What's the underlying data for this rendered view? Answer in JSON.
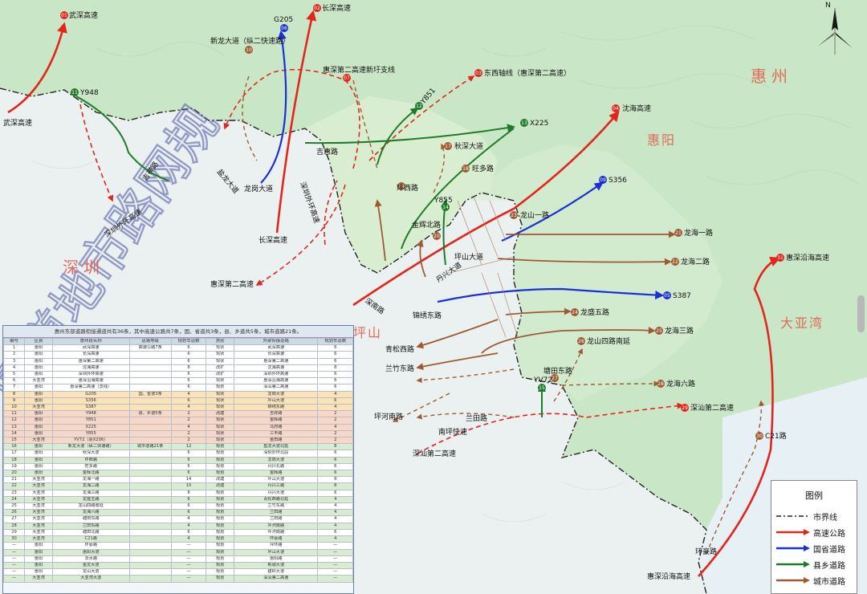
{
  "regions": {
    "shenzhen": "深圳",
    "huizhou": "惠州",
    "huiyang": "惠阳",
    "pingshan": "坪山",
    "dayawan": "大亚湾"
  },
  "watermark": "圆道地市路网规",
  "compass_label": "N",
  "colors": {
    "expressway": "#e3261d",
    "national_provincial": "#1b2fd6",
    "county_township": "#1f7a2a",
    "urban": "#a05a33",
    "boundary": "#222222"
  },
  "legend": {
    "title": "图例",
    "items": [
      {
        "label": "市界线",
        "style": "dashdot",
        "color": "#222222"
      },
      {
        "label": "高速公路",
        "style": "arrow",
        "color": "#e3261d"
      },
      {
        "label": "国省道路",
        "style": "arrow",
        "color": "#1b2fd6"
      },
      {
        "label": "县乡道路",
        "style": "arrow",
        "color": "#1f7a2a"
      },
      {
        "label": "城市道路",
        "style": "arrow",
        "color": "#a05a33"
      }
    ]
  },
  "map_labels": {
    "wushen_top": "武深高速",
    "wushen_left": "武深高速",
    "changshen_top": "长深高速",
    "changshen_mid": "长深高速",
    "g205": "G205",
    "xinlong": "新龙大道（纵二快速路）",
    "huishen2_new": "惠深第二高速新圩支线",
    "dongxi": "东西轴线（惠深第二高速）",
    "y948": "Y948",
    "jixiang": "吉祥路",
    "y851": "Y851",
    "shenhai": "沈海高速",
    "huiyang": "惠阳",
    "x225": "X225",
    "jihui": "吉惠路",
    "qiushen": "秋深大道",
    "yanglian": "盐龙大道",
    "longgang": "龙岗大道",
    "wangduo": "旺多路",
    "huanxi": "环西路",
    "shenhuan_out": "深圳外环高速",
    "shenhuan_in": "深圳外环高速",
    "s356": "S356",
    "y855": "Y855",
    "jinhui_n": "金辉北路",
    "longshan_rd": "龙山一路",
    "longhai1": "龙海一路",
    "longhai2": "龙海二路",
    "huishen_coast": "惠深沿海高速",
    "huishen2": "惠深第二高速",
    "shennan": "深南路",
    "s387": "S387",
    "pingshan_rd": "坪山大道",
    "danxing": "丹兴大道",
    "jinsui": "锦绣东路",
    "longsheng5": "龙盛五路",
    "longhai3": "龙海三路",
    "longshan4": "龙山四路南延",
    "qingsong": "青松西路",
    "lanzhu": "兰竹东路",
    "tangtian": "塘田东路",
    "yv72": "YV72",
    "longhai6": "龙海六路",
    "pinghe_s": "坪河南路",
    "lantian": "兰田路",
    "shenshan2": "深汕第二高速",
    "shenshan2_b": "深汕第二高速",
    "nanping": "南坪快速",
    "c21": "C21路",
    "huanhao": "环豪路",
    "huishen_coast_b": "惠深沿海高速"
  },
  "badges": [
    "01",
    "06",
    "02",
    "07",
    "03",
    "04",
    "10",
    "12",
    "14",
    "17",
    "18",
    "19",
    "20",
    "21",
    "22",
    "23",
    "24",
    "25",
    "26",
    "27",
    "28",
    "29",
    "30",
    "31",
    "05",
    "09",
    "11",
    "13",
    "15"
  ],
  "summary_table": {
    "title": "惠州东部道路衔接通道共有36条，其中高速公路共7条，国、省道共3条，县、乡道共5条，城市道路21条。",
    "headers": [
      "编号",
      "区县",
      "惠州段名称",
      "道路等级",
      "规划车道数",
      "类别",
      "外部衔接道路",
      "规划车道数"
    ],
    "rows": [
      [
        "1",
        "惠阳",
        "武深高速",
        "高速公路7条",
        "6",
        "现状",
        "武深高速",
        "6"
      ],
      [
        "2",
        "惠阳",
        "长深高速",
        "",
        "6",
        "现状",
        "长深高速",
        "6"
      ],
      [
        "3",
        "惠阳",
        "惠深第二高速",
        "",
        "6",
        "现状",
        "惠深第二高速",
        "6"
      ],
      [
        "4",
        "惠阳",
        "沈海高速",
        "",
        "8",
        "改扩",
        "沈海高速",
        "8"
      ],
      [
        "5",
        "惠阳",
        "深圳外环高速",
        "",
        "6",
        "改扩",
        "深圳外环高速",
        "6"
      ],
      [
        "6",
        "大亚湾",
        "惠深沿海高速",
        "",
        "6",
        "现状",
        "惠深沿海高速",
        "6"
      ],
      [
        "7",
        "惠阳",
        "惠深第二高速（支线）",
        "",
        "6",
        "规划",
        "深汕第二高速",
        "6"
      ],
      [
        "8",
        "惠阳",
        "G205",
        "国、省道3条",
        "4",
        "现状",
        "龙岗大道",
        "4"
      ],
      [
        "9",
        "惠阳",
        "S356",
        "",
        "6",
        "现状",
        "坪山大道",
        "6"
      ],
      [
        "10",
        "大亚湾",
        "S387",
        "",
        "4",
        "现状",
        "锦绣东路",
        "4"
      ],
      [
        "11",
        "惠阳",
        "Y948",
        "县、乡道5条",
        "2",
        "改建",
        "吉祥路",
        "2"
      ],
      [
        "12",
        "惠阳",
        "Y851",
        "",
        "2",
        "现状",
        "金辉路",
        "2"
      ],
      [
        "13",
        "惠阳",
        "X225",
        "",
        "4",
        "现状",
        "马狩路",
        "4"
      ],
      [
        "14",
        "惠阳",
        "Y855",
        "",
        "2",
        "现状",
        "三丰路",
        "2"
      ],
      [
        "15",
        "大亚湾",
        "YV72（原X206）",
        "",
        "2",
        "现状",
        "金田路",
        "2"
      ],
      [
        "16",
        "惠阳",
        "新龙大道（纵二快速路）",
        "城市道路21条",
        "12",
        "规划",
        "盐龙大道北延",
        "8"
      ],
      [
        "17",
        "惠阳",
        "秋深大道",
        "",
        "6",
        "规划",
        "深圳外环北段",
        "6"
      ],
      [
        "18",
        "惠阳",
        "环西路",
        "",
        "6",
        "规划",
        "龙岗大道",
        "6"
      ],
      [
        "19",
        "惠阳",
        "旺多路",
        "",
        "6",
        "规划",
        "丹兴北路",
        "6"
      ],
      [
        "20",
        "惠阳",
        "金辉北路",
        "",
        "6",
        "规划",
        "金辉路",
        "6"
      ],
      [
        "21",
        "大亚湾",
        "龙海一路",
        "",
        "14",
        "改建",
        "坪山大道",
        "8"
      ],
      [
        "22",
        "大亚湾",
        "龙海二路",
        "",
        "10",
        "改建",
        "丹兴三路",
        "8"
      ],
      [
        "23",
        "大亚湾",
        "龙海三路",
        "",
        "8",
        "规划",
        "丹兴大道",
        "6"
      ],
      [
        "24",
        "大亚湾",
        "龙盛五路",
        "",
        "6",
        "规划",
        "青松西路北延",
        "4"
      ],
      [
        "25",
        "大亚湾",
        "龙山四路南延",
        "",
        "6",
        "规划",
        "兰竹东路",
        "4"
      ],
      [
        "26",
        "大亚湾",
        "龙海六路",
        "",
        "6",
        "规划",
        "兰田路",
        "4"
      ],
      [
        "27",
        "大亚湾",
        "塘田东路",
        "",
        "4",
        "规划",
        "兰田路",
        "4"
      ],
      [
        "28",
        "大亚湾",
        "兰田东路",
        "",
        "4",
        "规划",
        "坪河南路",
        "4"
      ],
      [
        "29",
        "大亚湾",
        "塘田北路",
        "",
        "6",
        "规划",
        "坪河南路",
        "6"
      ],
      [
        "30",
        "大亚湾",
        "C21路",
        "",
        "4",
        "规划",
        "环豪路",
        "4"
      ],
      [
        "—",
        "惠阳",
        "环豪路",
        "",
        "—",
        "规划",
        "坪环路",
        "—"
      ],
      [
        "—",
        "惠阳",
        "惠阳大道",
        "",
        "—",
        "规划",
        "坪山大道",
        "—"
      ],
      [
        "—",
        "惠阳",
        "淡水路",
        "",
        "—",
        "规划",
        "惠阳路",
        "—"
      ],
      [
        "—",
        "惠阳",
        "金龙大道",
        "",
        "—",
        "规划",
        "新城大道",
        "—"
      ],
      [
        "—",
        "惠阳",
        "龙山大道",
        "",
        "—",
        "规划",
        "碧岭大道",
        "—"
      ],
      [
        "—",
        "大亚湾",
        "大亚湾大道",
        "",
        "—",
        "规划",
        "深汕第二高速",
        "—"
      ]
    ]
  }
}
